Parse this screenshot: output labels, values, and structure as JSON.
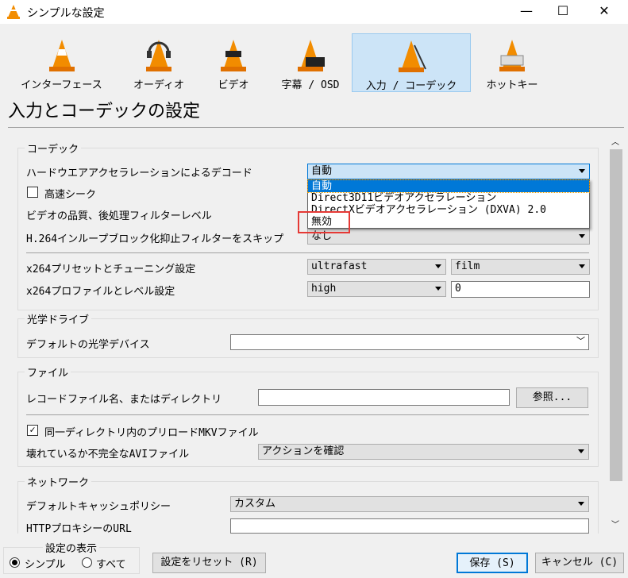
{
  "window": {
    "title": "シンプルな設定",
    "minimize": "—",
    "maximize": "☐",
    "close": "✕"
  },
  "tabs": [
    {
      "label": "インターフェース",
      "icon": "vlc-cone-icon"
    },
    {
      "label": "オーディオ",
      "icon": "headphones-cone-icon"
    },
    {
      "label": "ビデオ",
      "icon": "video-cone-icon"
    },
    {
      "label": "字幕 / OSD",
      "icon": "subtitles-cone-icon"
    },
    {
      "label": "入力 / コーデック",
      "icon": "input-codec-cone-icon",
      "selected": true
    },
    {
      "label": "ホットキー",
      "icon": "hotkeys-cone-icon"
    }
  ],
  "heading": "入力とコーデックの設定",
  "codec": {
    "title": "コーデック",
    "hw_label": "ハードウエアアクセラレーションによるデコード",
    "hw_value": "自動",
    "hw_options": [
      "自動",
      "Direct3D11ビデオアクセラレーション",
      "DirectXビデオアクセラレーション (DXVA) 2.0",
      "無効"
    ],
    "fast_seek": "高速シーク",
    "fast_seek_checked": false,
    "pp_label": "ビデオの品質、後処理フィルターレベル",
    "h264_label": "H.264インループブロック化抑止フィルターをスキップ",
    "h264_value": "なし",
    "x264_preset_label": "x264プリセットとチューニング設定",
    "preset": "ultrafast",
    "tune": "film",
    "x264_profile_label": "x264プロファイルとレベル設定",
    "profile": "high",
    "level": "0"
  },
  "optical": {
    "title": "光学ドライブ",
    "device_label": "デフォルトの光学デバイス",
    "device_value": ""
  },
  "file": {
    "title": "ファイル",
    "record_label": "レコードファイル名、またはディレクトリ",
    "record_value": "",
    "browse": "参照...",
    "mkv_label": "同一ディレクトリ内のプリロードMKVファイル",
    "mkv_checked": true,
    "avi_label": "壊れているか不完全なAVIファイル",
    "avi_value": "アクションを確認"
  },
  "network": {
    "title": "ネットワーク",
    "cache_label": "デフォルトキャッシュポリシー",
    "cache_value": "カスタム",
    "proxy_label": "HTTPプロキシーのURL",
    "proxy_value": ""
  },
  "footer": {
    "show_title": "設定の表示",
    "simple": "シンプル",
    "all": "すべて",
    "selected": "simple",
    "reset": "設定をリセット (R)",
    "save": "保存 (S)",
    "cancel": "キャンセル (C)"
  },
  "colors": {
    "accent": "#0078d7",
    "selected_tab": "#cce4f7",
    "highlight_box": "#e53935"
  }
}
